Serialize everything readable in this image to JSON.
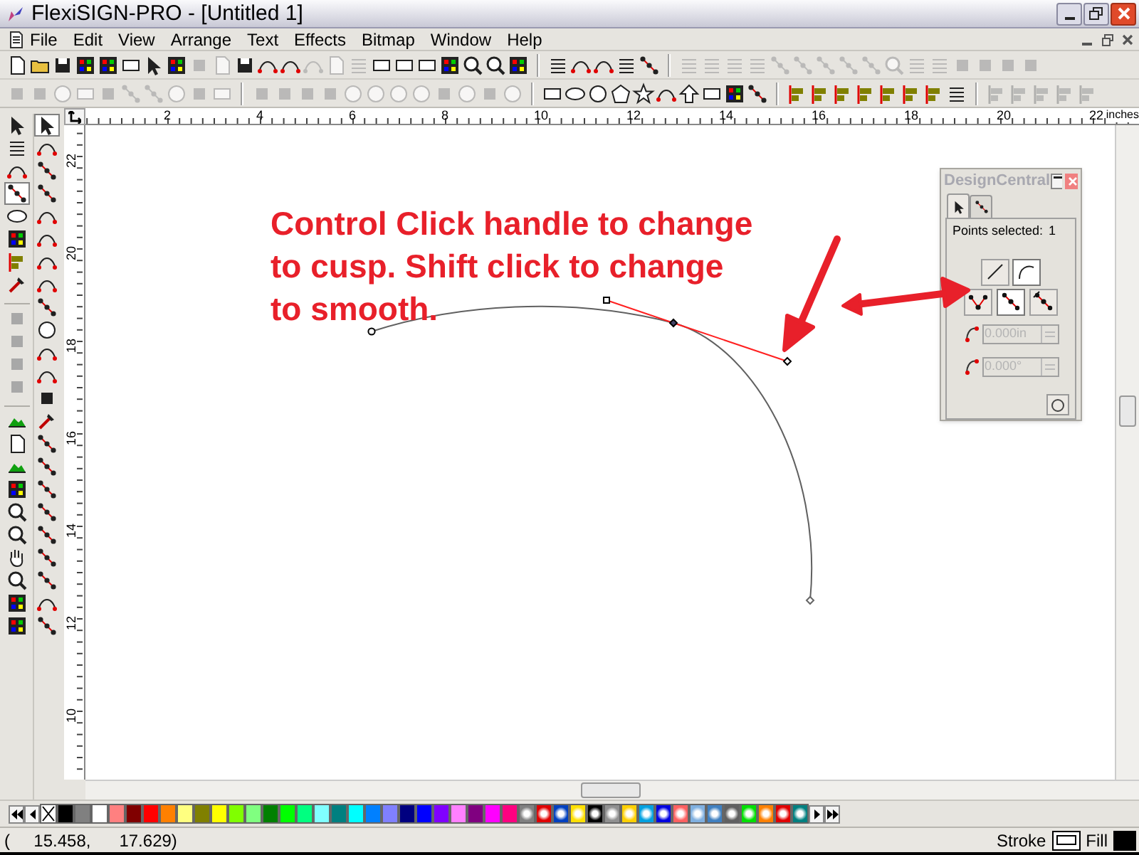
{
  "window": {
    "title": "FlexiSIGN-PRO - [Untitled 1]"
  },
  "menu": [
    "File",
    "Edit",
    "View",
    "Arrange",
    "Text",
    "Effects",
    "Bitmap",
    "Window",
    "Help"
  ],
  "toolbar_1": [
    {
      "disabled": false
    },
    {
      "disabled": true
    },
    {
      "disabled": false
    },
    {
      "disabled": true
    },
    {
      "disabled": false
    },
    {
      "disabled": false
    },
    {
      "disabled": true
    }
  ],
  "toolbar_2": [
    {
      "disabled": true
    },
    {
      "disabled": true
    },
    {
      "disabled": false
    },
    {
      "disabled": false
    },
    {
      "disabled": true
    }
  ],
  "toolbox_1": [
    {
      "selected": false,
      "disabled": false
    },
    {
      "selected": false,
      "disabled": false
    },
    {
      "selected": false,
      "disabled": false
    },
    {
      "selected": true,
      "disabled": false
    },
    {
      "selected": false,
      "disabled": false
    },
    {
      "selected": false,
      "disabled": false
    },
    {
      "selected": false,
      "disabled": false
    },
    {
      "selected": false,
      "disabled": false
    },
    {
      "selected": false,
      "disabled": true
    },
    {
      "selected": false,
      "disabled": true
    },
    {
      "selected": false,
      "disabled": true
    },
    {
      "selected": false,
      "disabled": true
    },
    {
      "selected": false,
      "disabled": false
    },
    {
      "selected": false,
      "disabled": false
    },
    {
      "selected": false,
      "disabled": false
    },
    {
      "selected": false,
      "disabled": false
    },
    {
      "selected": false,
      "disabled": false
    },
    {
      "selected": false,
      "disabled": false
    },
    {
      "selected": false,
      "disabled": false
    },
    {
      "selected": false,
      "disabled": false
    },
    {
      "selected": false,
      "disabled": false
    },
    {
      "selected": false,
      "disabled": false
    }
  ],
  "toolbox_2": [
    {
      "selected": true
    },
    {
      "selected": false
    },
    {
      "selected": false
    },
    {
      "selected": false
    },
    {
      "selected": false
    },
    {
      "selected": false
    },
    {
      "selected": false
    },
    {
      "selected": false
    },
    {
      "selected": false
    },
    {
      "selected": false
    },
    {
      "selected": false
    },
    {
      "selected": false
    },
    {
      "selected": false
    },
    {
      "selected": false
    },
    {
      "selected": false
    },
    {
      "selected": false
    },
    {
      "selected": false
    },
    {
      "selected": false
    },
    {
      "selected": false
    },
    {
      "selected": false
    },
    {
      "selected": false
    },
    {
      "selected": false
    },
    {
      "selected": false
    }
  ],
  "ruler_h": [
    "2",
    "4",
    "6",
    "8",
    "10",
    "12",
    "14",
    "16",
    "18",
    "20",
    "22"
  ],
  "ruler_unit": "inches",
  "ruler_v": [
    "22",
    "20",
    "18",
    "16",
    "14",
    "12",
    "10"
  ],
  "annotation": {
    "lines": [
      "Control Click handle to change",
      "to cusp. Shift click to change",
      "to smooth."
    ]
  },
  "design_central": {
    "title": "DesignCentral",
    "tabs": [
      {
        "selected": true
      },
      {
        "selected": false
      }
    ],
    "points_label": "Points selected:",
    "points_count": "1",
    "segment_buttons": [
      {
        "kind": "line",
        "selected": false
      },
      {
        "kind": "curve",
        "selected": true
      }
    ],
    "point_buttons": [
      {
        "kind": "cusp",
        "selected": false
      },
      {
        "kind": "smooth",
        "selected": true
      },
      {
        "kind": "symmetric",
        "selected": false
      }
    ],
    "fields": [
      {
        "value": "0.000in",
        "disabled": true
      },
      {
        "value": "0.000°",
        "disabled": true
      }
    ]
  },
  "palette": [
    {
      "kind": "none"
    },
    {
      "kind": "solid",
      "color": "#000000"
    },
    {
      "kind": "solid",
      "color": "#808080"
    },
    {
      "kind": "solid",
      "color": "#ffffff"
    },
    {
      "kind": "solid",
      "color": "#ff8080"
    },
    {
      "kind": "solid",
      "color": "#800000"
    },
    {
      "kind": "solid",
      "color": "#ff0000"
    },
    {
      "kind": "solid",
      "color": "#ff8000"
    },
    {
      "kind": "solid",
      "color": "#ffff80"
    },
    {
      "kind": "solid",
      "color": "#808000"
    },
    {
      "kind": "solid",
      "color": "#ffff00"
    },
    {
      "kind": "solid",
      "color": "#80ff00"
    },
    {
      "kind": "solid",
      "color": "#80ff80"
    },
    {
      "kind": "solid",
      "color": "#008000"
    },
    {
      "kind": "solid",
      "color": "#00ff00"
    },
    {
      "kind": "solid",
      "color": "#00ff80"
    },
    {
      "kind": "solid",
      "color": "#80ffff"
    },
    {
      "kind": "solid",
      "color": "#008080"
    },
    {
      "kind": "solid",
      "color": "#00ffff"
    },
    {
      "kind": "solid",
      "color": "#0080ff"
    },
    {
      "kind": "solid",
      "color": "#8080ff"
    },
    {
      "kind": "solid",
      "color": "#000080"
    },
    {
      "kind": "solid",
      "color": "#0000ff"
    },
    {
      "kind": "solid",
      "color": "#8000ff"
    },
    {
      "kind": "solid",
      "color": "#ff80ff"
    },
    {
      "kind": "solid",
      "color": "#800080"
    },
    {
      "kind": "solid",
      "color": "#ff00ff"
    },
    {
      "kind": "solid",
      "color": "#ff0080"
    },
    {
      "kind": "pattern",
      "color": "#808080"
    },
    {
      "kind": "pattern",
      "color": "#e00000"
    },
    {
      "kind": "pattern",
      "color": "#0040c0"
    },
    {
      "kind": "pattern",
      "color": "#ffe000"
    },
    {
      "kind": "pattern",
      "color": "#000000"
    },
    {
      "kind": "pattern",
      "color": "#909090"
    },
    {
      "kind": "pattern",
      "color": "#ffd000"
    },
    {
      "kind": "pattern",
      "color": "#00a0e0"
    },
    {
      "kind": "pattern",
      "color": "#0000e0"
    },
    {
      "kind": "pattern",
      "color": "#ff6060"
    },
    {
      "kind": "pattern",
      "color": "#80b0e0"
    },
    {
      "kind": "pattern",
      "color": "#4080c0"
    },
    {
      "kind": "pattern",
      "color": "#606060"
    },
    {
      "kind": "pattern",
      "color": "#00e000"
    },
    {
      "kind": "pattern",
      "color": "#ff8000"
    },
    {
      "kind": "pattern",
      "color": "#e00000"
    },
    {
      "kind": "pattern",
      "color": "#008080"
    }
  ],
  "status": {
    "coordinates": "(     15.458,      17.629)",
    "stroke_label": "Stroke",
    "fill_label": "Fill"
  }
}
